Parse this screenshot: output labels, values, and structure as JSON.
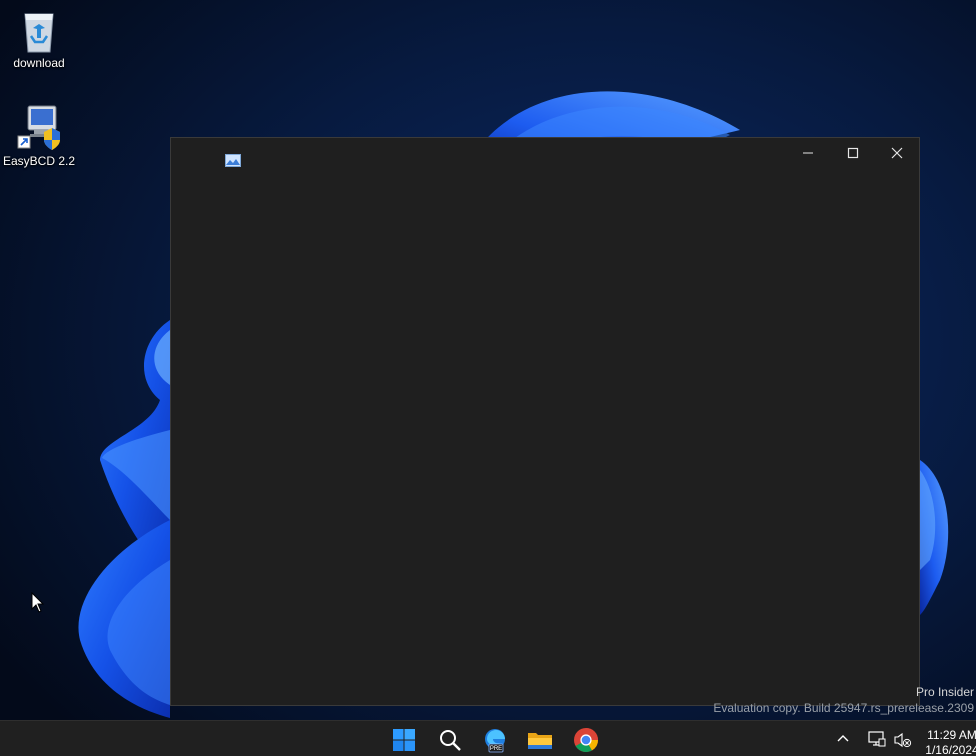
{
  "desktop": {
    "icons": [
      {
        "label": "download",
        "icon": "recycle-bin-icon"
      },
      {
        "label": "EasyBCD 2.2",
        "icon": "easybcd-icon"
      }
    ],
    "watermark": {
      "line1": "Pro Insider",
      "line2": "Evaluation copy. Build 25947.rs_prerelease.2309"
    }
  },
  "window": {
    "app_icon": "image-viewer-icon",
    "title": ""
  },
  "taskbar": {
    "apps": [
      {
        "name": "start",
        "icon": "windows-logo-icon"
      },
      {
        "name": "search",
        "icon": "search-icon"
      },
      {
        "name": "edge",
        "icon": "edge-beta-icon",
        "badge": "PRE"
      },
      {
        "name": "file-explorer",
        "icon": "folder-icon"
      },
      {
        "name": "chrome",
        "icon": "chrome-icon"
      }
    ],
    "clock": {
      "time": "11:29 AM",
      "date": "1/16/2024"
    }
  }
}
